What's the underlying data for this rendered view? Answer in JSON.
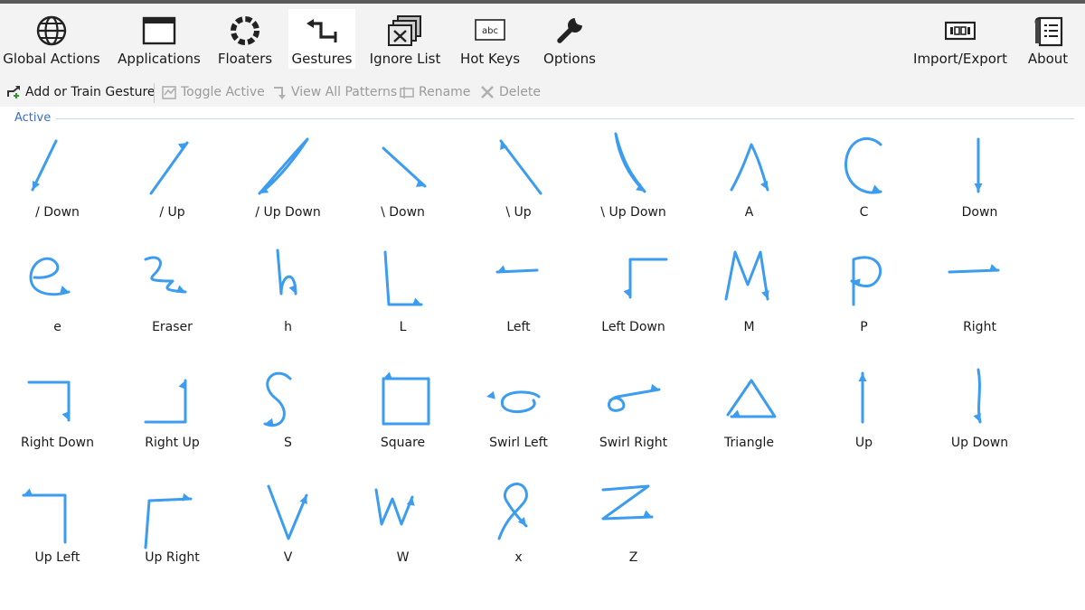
{
  "ribbon": {
    "items": [
      {
        "label": "Global Actions",
        "icon": "globe-icon"
      },
      {
        "label": "Applications",
        "icon": "window-icon"
      },
      {
        "label": "Floaters",
        "icon": "ring-icon"
      },
      {
        "label": "Gestures",
        "icon": "gesture-icon",
        "selected": true
      },
      {
        "label": "Ignore List",
        "icon": "stacked-windows-icon"
      },
      {
        "label": "Hot Keys",
        "icon": "keyboard-key-icon",
        "key_text": "abc"
      },
      {
        "label": "Options",
        "icon": "wrench-icon"
      },
      {
        "label": "Import/Export",
        "icon": "import-export-icon"
      },
      {
        "label": "About",
        "icon": "about-scroll-icon"
      }
    ]
  },
  "toolbar": {
    "add_label": "Add or Train Gesture",
    "toggle_label": "Toggle Active",
    "view_label": "View All Patterns",
    "rename_label": "Rename",
    "delete_label": "Delete"
  },
  "group": {
    "header": "Active"
  },
  "gestures": [
    "/ Down",
    "/ Up",
    "/ Up Down",
    "\\ Down",
    "\\ Up",
    "\\ Up Down",
    "A",
    "C",
    "Down",
    "e",
    "Eraser",
    "h",
    "L",
    "Left",
    "Left Down",
    "M",
    "P",
    "Right",
    "Right Down",
    "Right Up",
    "S",
    "Square",
    "Swirl Left",
    "Swirl Right",
    "Triangle",
    "Up",
    "Up Down",
    "Up Left",
    "Up Right",
    "V",
    "W",
    "x",
    "Z"
  ],
  "colors": {
    "stroke": "#3b9cf0",
    "accent": "#3a6fc9",
    "disabled": "#9a9a9a"
  }
}
